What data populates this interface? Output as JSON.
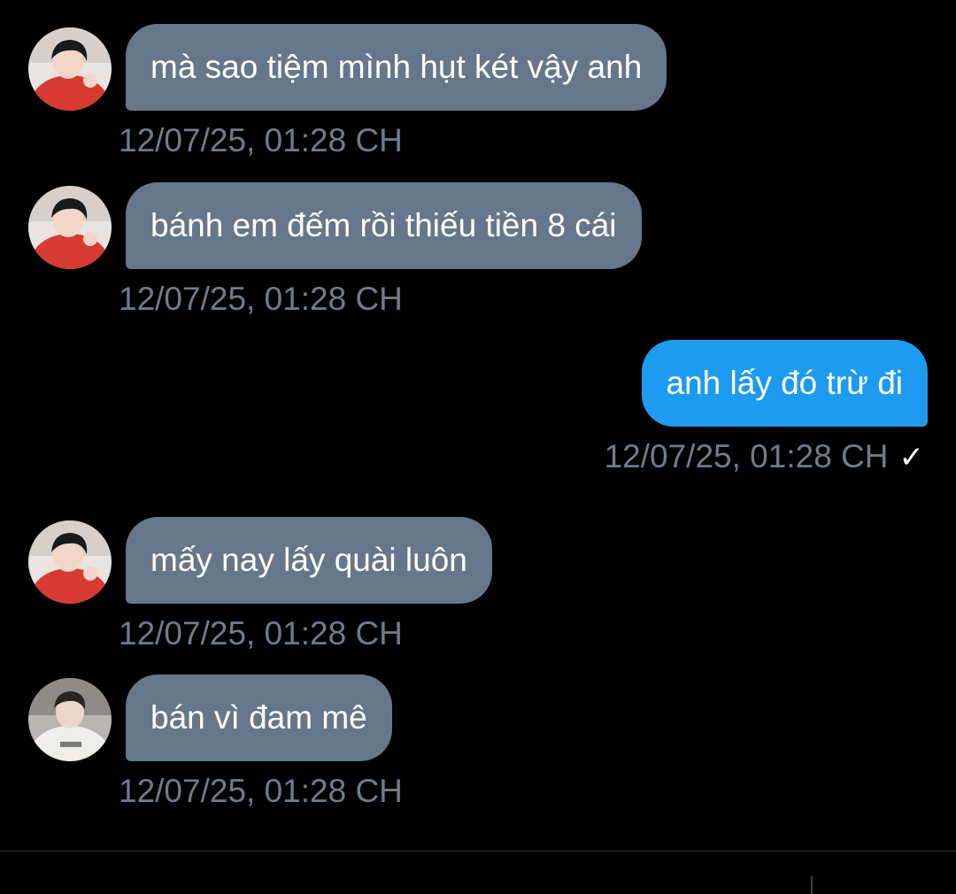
{
  "conversation": {
    "messages": [
      {
        "direction": "in",
        "avatar": "avatar-red-shirt",
        "text": "mà sao tiệm mình hụt két vậy anh",
        "time": "12/07/25, 01:28 CH"
      },
      {
        "direction": "in",
        "avatar": "avatar-red-shirt",
        "text": "bánh em đếm rồi thiếu tiền 8 cái",
        "time": "12/07/25, 01:28 CH"
      },
      {
        "direction": "out",
        "text": "anh lấy đó trừ đi",
        "time": "12/07/25, 01:28 CH",
        "status_icon": "checkmark-icon",
        "status_glyph": "✓"
      },
      {
        "direction": "in",
        "avatar": "avatar-red-shirt",
        "text": "mấy nay lấy quài luôn",
        "time": "12/07/25, 01:28 CH"
      },
      {
        "direction": "in",
        "avatar": "avatar-white-shirt",
        "text": "bán vì đam mê",
        "time": "12/07/25, 01:28 CH"
      }
    ]
  },
  "colors": {
    "background": "#000000",
    "incoming_bubble": "#66778a",
    "outgoing_bubble": "#1d9bf0",
    "timestamp": "#6e7c8c",
    "text": "#ffffff"
  }
}
